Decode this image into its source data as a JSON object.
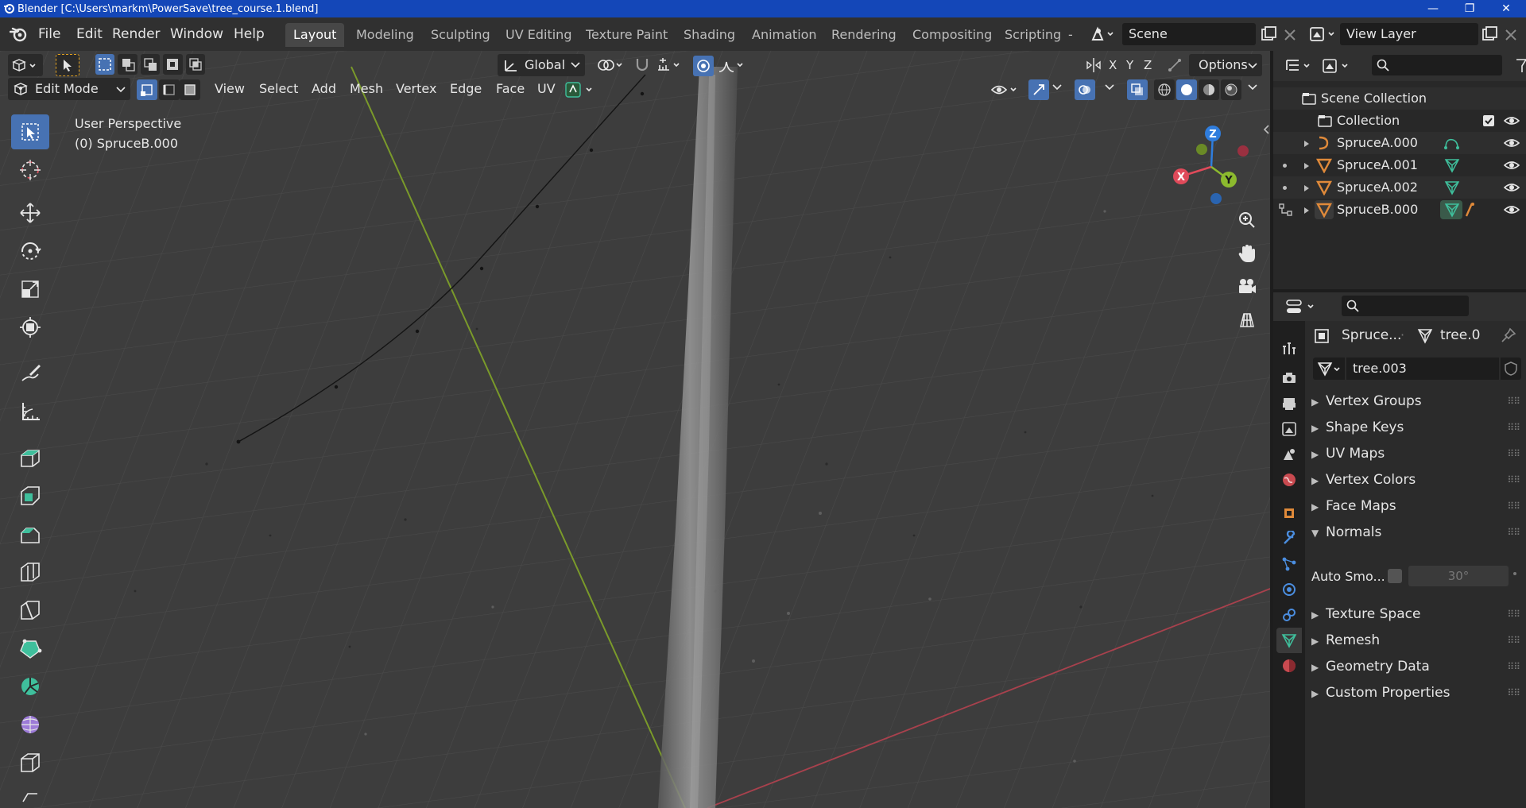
{
  "window": {
    "title": "Blender [C:\\Users\\markm\\PowerSave\\tree_course.1.blend]",
    "minimize": "—",
    "maximize": "❐",
    "close": "✕"
  },
  "menu": [
    "File",
    "Edit",
    "Render",
    "Window",
    "Help"
  ],
  "workspaces": [
    "Layout",
    "Modeling",
    "Sculpting",
    "UV Editing",
    "Texture Paint",
    "Shading",
    "Animation",
    "Rendering",
    "Compositing",
    "Scripting"
  ],
  "workspaces_more": "-",
  "scene": {
    "name": "Scene"
  },
  "view_layer": {
    "name": "View Layer"
  },
  "viewport_header": {
    "transform_orientation": "Global",
    "options_label": "Options",
    "mode": "Edit Mode",
    "menus": [
      "View",
      "Select",
      "Add",
      "Mesh",
      "Vertex",
      "Edge",
      "Face",
      "UV"
    ],
    "axis_x": "X",
    "axis_y": "Y",
    "axis_z": "Z"
  },
  "viewport": {
    "perspective": "User Perspective",
    "object": "(0) SpruceB.000"
  },
  "gizmo": {
    "x": "X",
    "y": "Y",
    "z": "Z"
  },
  "outliner": {
    "root": "Scene Collection",
    "collection": "Collection",
    "items": [
      {
        "name": "SpruceA.000"
      },
      {
        "name": "SpruceA.001"
      },
      {
        "name": "SpruceA.002"
      },
      {
        "name": "SpruceB.000"
      }
    ]
  },
  "properties": {
    "object_short": "Spruce...",
    "mesh_short": "tree.0",
    "datablock": "tree.003",
    "panels_top": [
      "Vertex Groups",
      "Shape Keys",
      "UV Maps",
      "Vertex Colors",
      "Face Maps"
    ],
    "normals": "Normals",
    "auto_smooth_label": "Auto Smo...",
    "auto_smooth_angle": "30°",
    "panels_bottom": [
      "Texture Space",
      "Remesh",
      "Geometry Data",
      "Custom Properties"
    ]
  },
  "colors": {
    "accent": "#4772b3",
    "axis_x": "#e04a5a",
    "axis_y": "#8cba2e",
    "axis_z": "#2f7ddd",
    "mesh_icon": "#3fbf9c",
    "object_orange": "#e08a3a"
  }
}
